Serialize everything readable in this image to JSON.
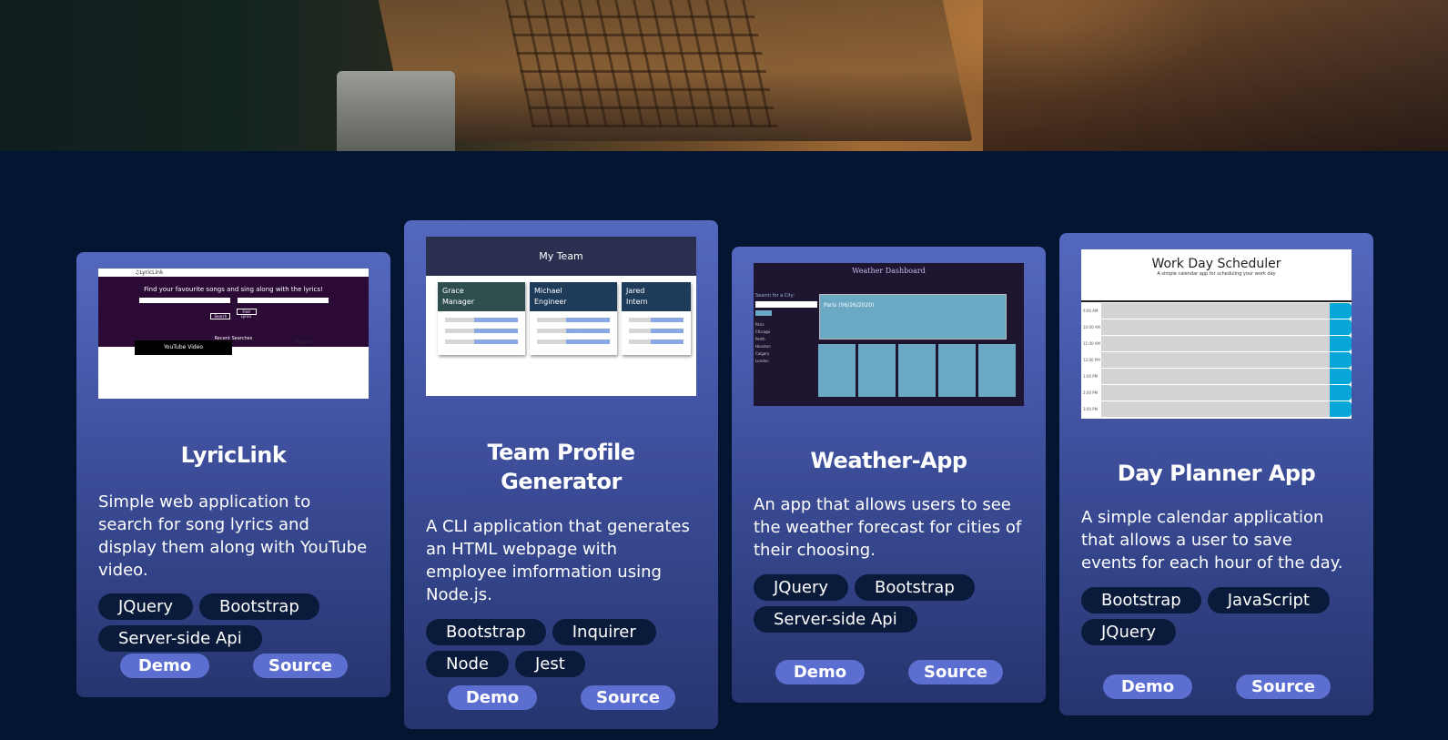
{
  "projects": [
    {
      "title": "LyricLink",
      "description": "Simple web application to search for song lyrics and display them along with YouTube video.",
      "tags": [
        "JQuery",
        "Bootstrap",
        "Server-side Api"
      ],
      "demo_label": "Demo",
      "source_label": "Source",
      "thumbnail": {
        "logo": "♫LyricLink",
        "headline": "Find your favourite songs and sing along with the lyrics!",
        "search_label": "Search",
        "find_label": "Find Lyrics",
        "recent": "Recent Searches",
        "video": "YouTube Video",
        "lyrics": "The Lyrics"
      }
    },
    {
      "title": "Team Profile Generator",
      "description": "A CLI application that generates an HTML webpage with employee imformation using Node.js.",
      "tags": [
        "Bootstrap",
        "Inquirer",
        "Node",
        "Jest"
      ],
      "demo_label": "Demo",
      "source_label": "Source",
      "thumbnail": {
        "header": "My Team",
        "members": [
          {
            "name": "Grace",
            "role": "Manager",
            "color": "#2f4f4f"
          },
          {
            "name": "Michael",
            "role": "Engineer",
            "color": "#1f3b5a"
          },
          {
            "name": "Jared",
            "role": "Intern",
            "color": "#1f3b5a"
          }
        ]
      }
    },
    {
      "title": "Weather-App",
      "description": "An app that allows users to see the weather forecast for cities of their choosing.",
      "tags": [
        "JQuery",
        "Bootstrap",
        "Server-side Api"
      ],
      "demo_label": "Demo",
      "source_label": "Source",
      "thumbnail": {
        "header": "Weather Dashboard",
        "search": "Search for a City:",
        "cities": [
          "Paris",
          "Chicago",
          "Perth",
          "Houston",
          "Calgary",
          "London"
        ],
        "current": "Paris (06/26/2020)"
      }
    },
    {
      "title": "Day Planner App",
      "description": "A simple calendar application that allows a user to save events for each hour of the day.",
      "tags": [
        "Bootstrap",
        "JavaScript",
        "JQuery"
      ],
      "demo_label": "Demo",
      "source_label": "Source",
      "thumbnail": {
        "header": "Work Day Scheduler",
        "sub": "A simple calendar app for scheduling your work day",
        "hours": [
          "9:00 AM",
          "10:00 AM",
          "11:00 AM",
          "12:00 PM",
          "1:00 PM",
          "2:00 PM",
          "3:00 PM"
        ]
      }
    }
  ],
  "colors": {
    "page_bg": "#031531",
    "card_top": "#5468bf",
    "card_bottom": "#25356f",
    "tag_bg": "#0a1a3a",
    "button_bg": "#5c6fd0"
  }
}
